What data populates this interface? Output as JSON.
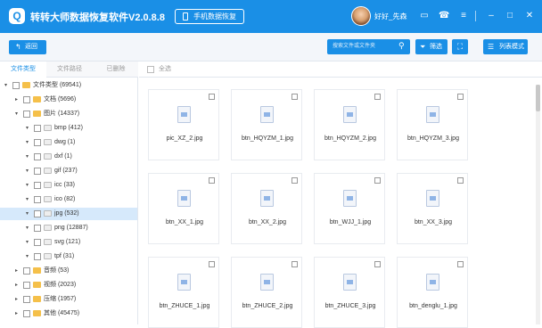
{
  "app": {
    "title": "转转大师数据恢复软件V2.0.8.8",
    "mobile_btn": "手机数据恢复",
    "username": "好好_先森"
  },
  "toolbar": {
    "back_label": "返回",
    "search_placeholder": "搜索文件或文件夹",
    "filter_label": "筛选",
    "list_mode_label": "列表模式"
  },
  "tabs": [
    "文件类型",
    "文件路径",
    "已删除"
  ],
  "tree": [
    {
      "label": "文件类型 (69541)",
      "level": 0,
      "expanded": true,
      "icon": "folder"
    },
    {
      "label": "文档 (5696)",
      "level": 1,
      "expanded": false,
      "icon": "folder"
    },
    {
      "label": "图片 (14337)",
      "level": 1,
      "expanded": true,
      "icon": "folder"
    },
    {
      "label": "bmp (412)",
      "level": 2,
      "expanded": true,
      "icon": "image"
    },
    {
      "label": "dwg (1)",
      "level": 2,
      "expanded": true,
      "icon": "image"
    },
    {
      "label": "dxf (1)",
      "level": 2,
      "expanded": true,
      "icon": "image"
    },
    {
      "label": "gif (237)",
      "level": 2,
      "expanded": true,
      "icon": "image"
    },
    {
      "label": "icc (33)",
      "level": 2,
      "expanded": true,
      "icon": "image"
    },
    {
      "label": "ico (82)",
      "level": 2,
      "expanded": true,
      "icon": "image"
    },
    {
      "label": "jpg (532)",
      "level": 2,
      "expanded": true,
      "icon": "image",
      "selected": true
    },
    {
      "label": "png (12887)",
      "level": 2,
      "expanded": true,
      "icon": "image"
    },
    {
      "label": "svg (121)",
      "level": 2,
      "expanded": true,
      "icon": "image"
    },
    {
      "label": "tpf (31)",
      "level": 2,
      "expanded": true,
      "icon": "image"
    },
    {
      "label": "音频 (53)",
      "level": 1,
      "expanded": false,
      "icon": "folder"
    },
    {
      "label": "视频 (2023)",
      "level": 1,
      "expanded": false,
      "icon": "folder"
    },
    {
      "label": "压缩 (1957)",
      "level": 1,
      "expanded": false,
      "icon": "folder"
    },
    {
      "label": "其他 (45475)",
      "level": 1,
      "expanded": false,
      "icon": "folder"
    }
  ],
  "select_all_label": "全选",
  "files": [
    "pic_XZ_2.jpg",
    "btn_HQYZM_1.jpg",
    "btn_HQYZM_2.jpg",
    "btn_HQYZM_3.jpg",
    "btn_XX_1.jpg",
    "btn_XX_2.jpg",
    "btn_WJJ_1.jpg",
    "btn_XX_3.jpg",
    "btn_ZHUCE_1.jpg",
    "btn_ZHUCE_2.jpg",
    "btn_ZHUCE_3.jpg",
    "btn_denglu_1.jpg"
  ],
  "colors": {
    "accent": "#1a8fe6",
    "selected_row": "#d6e9fb"
  }
}
